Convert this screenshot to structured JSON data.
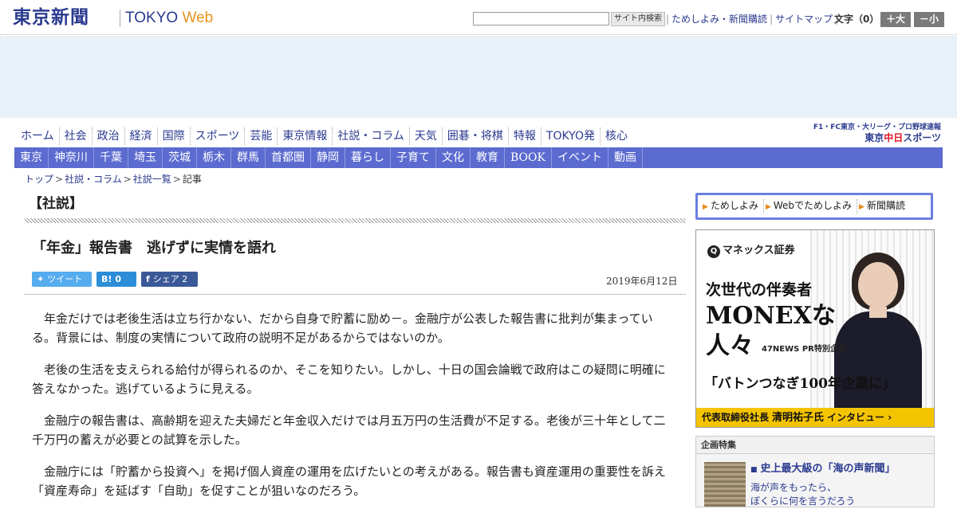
{
  "header": {
    "logo_jp": "東京新聞",
    "logo_en": "TOKYO",
    "logo_web": "Web",
    "search_placeholder": "",
    "search_button": "サイト内検索",
    "links": [
      "ためしよみ・新聞購読",
      "サイトマップ"
    ],
    "font_size_label": "文字（0）",
    "font_large": "＋大",
    "font_small": "－小"
  },
  "nav_main": [
    "ホーム",
    "社会",
    "政治",
    "経済",
    "国際",
    "スポーツ",
    "芸能",
    "東京情報",
    "社説・コラム",
    "天気",
    "囲碁・将棋",
    "特報",
    "TOKYO発",
    "核心"
  ],
  "sports_banner": {
    "top": "F1・FC東京・大リーグ・プロ野球速報",
    "logo_prefix": "東京",
    "logo_chu": "中日",
    "logo_suffix": "スポーツ"
  },
  "nav_region": [
    "東京",
    "神奈川",
    "千葉",
    "埼玉",
    "茨城",
    "栃木",
    "群馬",
    "首都圏",
    "静岡",
    "暮らし",
    "子育て",
    "文化",
    "教育",
    "BOOK",
    "イベント",
    "動画"
  ],
  "breadcrumb": {
    "items": [
      "トップ",
      "社説・コラム",
      "社説一覧"
    ],
    "current": "記事"
  },
  "article": {
    "section": "【社説】",
    "headline": "「年金」報告書　逃げずに実情を語れ",
    "date": "2019年6月12日",
    "share": {
      "tweet": "ツイート",
      "hatena_count": "0",
      "facebook": "シェア",
      "facebook_count": "2"
    },
    "paragraphs": [
      "年金だけでは老後生活は立ち行かない、だから自身で貯蓄に励め－。金融庁が公表した報告書に批判が集まっている。背景には、制度の実情について政府の説明不足があるからではないのか。",
      "老後の生活を支えられる給付が得られるのか、そこを知りたい。しかし、十日の国会論戦で政府はこの疑問に明確に答えなかった。逃げているように見える。",
      "金融庁の報告書は、高齢期を迎えた夫婦だと年金収入だけでは月五万円の生活費が不足する。老後が三十年として二千万円の蓄えが必要との試算を示した。",
      "金融庁には「貯蓄から投資へ」を掲げ個人資産の運用を広げたいとの考えがある。報告書も資産運用の重要性を訴え「資産寿命」を延ばす「自助」を促すことが狙いなのだろう。"
    ]
  },
  "sidebar": {
    "sub_nav": [
      "ためしよみ",
      "Webでためしよみ",
      "新聞購読"
    ],
    "ad": {
      "brand": "マネックス証券",
      "line1": "次世代の伴奏者",
      "line2": "MONEXな",
      "line3": "人々",
      "pr": "47NEWS PR特別企画",
      "quote": "「バトンつなぎ100年企業に」",
      "bar_role": "代表取締役社長",
      "bar_name": "清明祐子氏",
      "bar_suffix": "インタビュー ›"
    },
    "special": {
      "heading": "企画特集",
      "title": "史上最大級の「海の声新聞」",
      "desc_line1": "海が声をもったら、",
      "desc_line2": "ぼくらに何を言うだろう"
    }
  }
}
